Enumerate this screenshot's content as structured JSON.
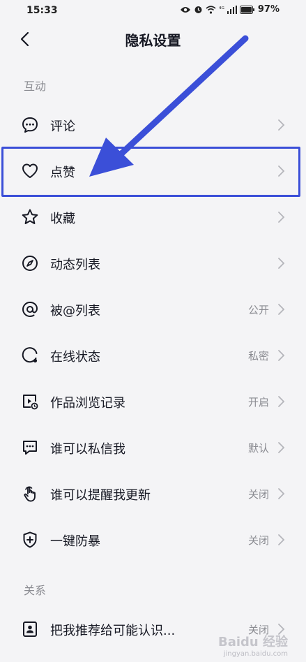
{
  "status_bar": {
    "time": "15:33",
    "signal_text": "⁴ᴳ",
    "battery": "97%"
  },
  "nav": {
    "title": "隐私设置"
  },
  "sections": {
    "interaction": "互动",
    "relationship": "关系"
  },
  "rows": [
    {
      "label": "评论",
      "value": "",
      "icon": "comment-icon"
    },
    {
      "label": "点赞",
      "value": "",
      "icon": "heart-icon"
    },
    {
      "label": "收藏",
      "value": "",
      "icon": "star-icon"
    },
    {
      "label": "动态列表",
      "value": "",
      "icon": "compass-icon"
    },
    {
      "label": "被@列表",
      "value": "公开",
      "icon": "at-icon"
    },
    {
      "label": "在线状态",
      "value": "私密",
      "icon": "online-status-icon"
    },
    {
      "label": "作品浏览记录",
      "value": "开启",
      "icon": "play-history-icon"
    },
    {
      "label": "谁可以私信我",
      "value": "默认",
      "icon": "message-icon"
    },
    {
      "label": "谁可以提醒我更新",
      "value": "关闭",
      "icon": "hand-tap-icon"
    },
    {
      "label": "一键防暴",
      "value": "关闭",
      "icon": "shield-plus-icon"
    },
    {
      "label": "把我推荐给可能认识...",
      "value": "关闭",
      "icon": "contact-card-icon"
    }
  ],
  "annotation": {
    "color": "#3b4fd8",
    "highlighted_row": "点赞"
  },
  "watermark": {
    "main": "Baidu 经验",
    "sub": "jingyan.baidu.com"
  },
  "colors": {
    "background": "#f4f4f6",
    "text": "#161823",
    "secondary": "#8a8b91",
    "annotation": "#3b4fd8"
  }
}
